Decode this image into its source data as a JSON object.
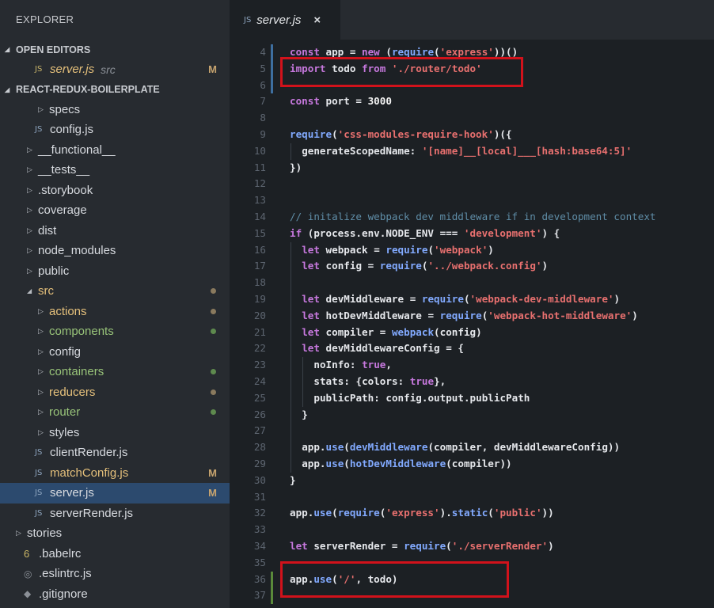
{
  "sidebar": {
    "title": "EXPLORER",
    "open_editors": {
      "header": "OPEN EDITORS",
      "files": [
        {
          "name": "server.js",
          "desc": "src",
          "status": "M"
        }
      ]
    },
    "project": {
      "header": "REACT-REDUX-BOILERPLATE",
      "items": [
        {
          "label": "specs",
          "kind": "folder",
          "depth": 2
        },
        {
          "label": "config.js",
          "kind": "js",
          "depth": 1
        },
        {
          "label": "__functional__",
          "kind": "folder",
          "depth": 1
        },
        {
          "label": "__tests__",
          "kind": "folder",
          "depth": 1
        },
        {
          "label": ".storybook",
          "kind": "folder",
          "depth": 1
        },
        {
          "label": "coverage",
          "kind": "folder",
          "depth": 1
        },
        {
          "label": "dist",
          "kind": "folder",
          "depth": 1
        },
        {
          "label": "node_modules",
          "kind": "folder",
          "depth": 1
        },
        {
          "label": "public",
          "kind": "folder",
          "depth": 1
        },
        {
          "label": "src",
          "kind": "folder-open",
          "depth": 1,
          "color": "#e5c07b",
          "dot": "#8a7a5e"
        },
        {
          "label": "actions",
          "kind": "folder",
          "depth": 2,
          "color": "#e5c07b",
          "dot": "#8a7a5e"
        },
        {
          "label": "components",
          "kind": "folder",
          "depth": 2,
          "color": "#98c379",
          "dot": "#5e8a4e"
        },
        {
          "label": "config",
          "kind": "folder",
          "depth": 2
        },
        {
          "label": "containers",
          "kind": "folder",
          "depth": 2,
          "color": "#98c379",
          "dot": "#5e8a4e"
        },
        {
          "label": "reducers",
          "kind": "folder",
          "depth": 2,
          "color": "#e5c07b",
          "dot": "#8a7a5e"
        },
        {
          "label": "router",
          "kind": "folder",
          "depth": 2,
          "color": "#98c379",
          "dot": "#5e8a4e"
        },
        {
          "label": "styles",
          "kind": "folder",
          "depth": 2
        },
        {
          "label": "clientRender.js",
          "kind": "js",
          "depth": 1
        },
        {
          "label": "matchConfig.js",
          "kind": "js",
          "depth": 1,
          "color": "#e5c07b",
          "status": "M"
        },
        {
          "label": "server.js",
          "kind": "js",
          "depth": 1,
          "status": "M",
          "selected": true
        },
        {
          "label": "serverRender.js",
          "kind": "js",
          "depth": 1
        },
        {
          "label": "stories",
          "kind": "folder",
          "depth": 0
        },
        {
          "label": ".babelrc",
          "kind": "babel",
          "depth": 0
        },
        {
          "label": ".eslintrc.js",
          "kind": "eslint",
          "depth": 0
        },
        {
          "label": ".gitignore",
          "kind": "git",
          "depth": 0
        }
      ]
    }
  },
  "editor": {
    "tab": {
      "label": "server.js",
      "close": "×"
    },
    "lines": [
      {
        "n": "4",
        "indent": 0,
        "mark": "#3e6fa0",
        "tokens": [
          [
            "kw",
            "const "
          ],
          [
            "plain",
            "app "
          ],
          [
            "plain",
            "= "
          ],
          [
            "kw",
            "new "
          ],
          [
            "plain",
            "("
          ],
          [
            "var",
            "require"
          ],
          [
            "plain",
            "("
          ],
          [
            "str",
            "'express'"
          ],
          [
            "plain",
            "))()"
          ]
        ]
      },
      {
        "n": "5",
        "indent": 0,
        "mark": "#3e6fa0",
        "tokens": [
          [
            "kw",
            "import "
          ],
          [
            "plain",
            "todo "
          ],
          [
            "kw",
            "from "
          ],
          [
            "str",
            "'./router/todo'"
          ]
        ]
      },
      {
        "n": "6",
        "indent": 0,
        "mark": "#3e6fa0",
        "tokens": []
      },
      {
        "n": "7",
        "indent": 0,
        "tokens": [
          [
            "kw",
            "const "
          ],
          [
            "plain",
            "port "
          ],
          [
            "plain",
            "= "
          ],
          [
            "num",
            "3000"
          ]
        ]
      },
      {
        "n": "8",
        "indent": 0,
        "tokens": []
      },
      {
        "n": "9",
        "indent": 0,
        "tokens": [
          [
            "var",
            "require"
          ],
          [
            "plain",
            "("
          ],
          [
            "str",
            "'css-modules-require-hook'"
          ],
          [
            "plain",
            ")({"
          ]
        ]
      },
      {
        "n": "10",
        "indent": 1,
        "tokens": [
          [
            "prop",
            "generateScopedName"
          ],
          [
            "plain",
            ": "
          ],
          [
            "str",
            "'[name]__[local]___[hash:base64:5]'"
          ]
        ]
      },
      {
        "n": "11",
        "indent": 0,
        "tokens": [
          [
            "plain",
            "})"
          ]
        ]
      },
      {
        "n": "12",
        "indent": 0,
        "tokens": []
      },
      {
        "n": "13",
        "indent": 0,
        "tokens": []
      },
      {
        "n": "14",
        "indent": 0,
        "tokens": [
          [
            "cmt",
            "// initalize webpack dev middleware if in development context"
          ]
        ]
      },
      {
        "n": "15",
        "indent": 0,
        "tokens": [
          [
            "kw",
            "if "
          ],
          [
            "plain",
            "(process.env.NODE_ENV "
          ],
          [
            "plain",
            "=== "
          ],
          [
            "str",
            "'development'"
          ],
          [
            "plain",
            ") {"
          ]
        ]
      },
      {
        "n": "16",
        "indent": 1,
        "tokens": [
          [
            "kw",
            "let "
          ],
          [
            "plain",
            "webpack "
          ],
          [
            "plain",
            "= "
          ],
          [
            "var",
            "require"
          ],
          [
            "plain",
            "("
          ],
          [
            "str",
            "'webpack'"
          ],
          [
            "plain",
            ")"
          ]
        ]
      },
      {
        "n": "17",
        "indent": 1,
        "tokens": [
          [
            "kw",
            "let "
          ],
          [
            "plain",
            "config "
          ],
          [
            "plain",
            "= "
          ],
          [
            "var",
            "require"
          ],
          [
            "plain",
            "("
          ],
          [
            "str",
            "'../webpack.config'"
          ],
          [
            "plain",
            ")"
          ]
        ]
      },
      {
        "n": "18",
        "indent": 1,
        "tokens": []
      },
      {
        "n": "19",
        "indent": 1,
        "tokens": [
          [
            "kw",
            "let "
          ],
          [
            "plain",
            "devMiddleware "
          ],
          [
            "plain",
            "= "
          ],
          [
            "var",
            "require"
          ],
          [
            "plain",
            "("
          ],
          [
            "str",
            "'webpack-dev-middleware'"
          ],
          [
            "plain",
            ")"
          ]
        ]
      },
      {
        "n": "20",
        "indent": 1,
        "tokens": [
          [
            "kw",
            "let "
          ],
          [
            "plain",
            "hotDevMiddleware "
          ],
          [
            "plain",
            "= "
          ],
          [
            "var",
            "require"
          ],
          [
            "plain",
            "("
          ],
          [
            "str",
            "'webpack-hot-middleware'"
          ],
          [
            "plain",
            ")"
          ]
        ]
      },
      {
        "n": "21",
        "indent": 1,
        "tokens": [
          [
            "kw",
            "let "
          ],
          [
            "plain",
            "compiler "
          ],
          [
            "plain",
            "= "
          ],
          [
            "var",
            "webpack"
          ],
          [
            "plain",
            "(config)"
          ]
        ]
      },
      {
        "n": "22",
        "indent": 1,
        "tokens": [
          [
            "kw",
            "let "
          ],
          [
            "plain",
            "devMiddlewareConfig "
          ],
          [
            "plain",
            "= {"
          ]
        ]
      },
      {
        "n": "23",
        "indent": 2,
        "tokens": [
          [
            "prop",
            "noInfo"
          ],
          [
            "plain",
            ": "
          ],
          [
            "kw",
            "true"
          ],
          [
            "plain",
            ","
          ]
        ]
      },
      {
        "n": "24",
        "indent": 2,
        "tokens": [
          [
            "prop",
            "stats"
          ],
          [
            "plain",
            ": {"
          ],
          [
            "prop",
            "colors"
          ],
          [
            "plain",
            ": "
          ],
          [
            "kw",
            "true"
          ],
          [
            "plain",
            "},"
          ]
        ]
      },
      {
        "n": "25",
        "indent": 2,
        "tokens": [
          [
            "prop",
            "publicPath"
          ],
          [
            "plain",
            ": config.output.publicPath"
          ]
        ]
      },
      {
        "n": "26",
        "indent": 1,
        "tokens": [
          [
            "plain",
            "}"
          ]
        ]
      },
      {
        "n": "27",
        "indent": 1,
        "tokens": []
      },
      {
        "n": "28",
        "indent": 1,
        "tokens": [
          [
            "plain",
            "app."
          ],
          [
            "var",
            "use"
          ],
          [
            "plain",
            "("
          ],
          [
            "var",
            "devMiddleware"
          ],
          [
            "plain",
            "(compiler, devMiddlewareConfig))"
          ]
        ]
      },
      {
        "n": "29",
        "indent": 1,
        "tokens": [
          [
            "plain",
            "app."
          ],
          [
            "var",
            "use"
          ],
          [
            "plain",
            "("
          ],
          [
            "var",
            "hotDevMiddleware"
          ],
          [
            "plain",
            "(compiler))"
          ]
        ]
      },
      {
        "n": "30",
        "indent": 0,
        "tokens": [
          [
            "plain",
            "}"
          ]
        ]
      },
      {
        "n": "31",
        "indent": 0,
        "tokens": []
      },
      {
        "n": "32",
        "indent": 0,
        "tokens": [
          [
            "plain",
            "app."
          ],
          [
            "var",
            "use"
          ],
          [
            "plain",
            "("
          ],
          [
            "var",
            "require"
          ],
          [
            "plain",
            "("
          ],
          [
            "str",
            "'express'"
          ],
          [
            "plain",
            ")."
          ],
          [
            "var",
            "static"
          ],
          [
            "plain",
            "("
          ],
          [
            "str",
            "'public'"
          ],
          [
            "plain",
            "))"
          ]
        ]
      },
      {
        "n": "33",
        "indent": 0,
        "tokens": []
      },
      {
        "n": "34",
        "indent": 0,
        "tokens": [
          [
            "kw",
            "let "
          ],
          [
            "plain",
            "serverRender "
          ],
          [
            "plain",
            "= "
          ],
          [
            "var",
            "require"
          ],
          [
            "plain",
            "("
          ],
          [
            "str",
            "'./serverRender'"
          ],
          [
            "plain",
            ")"
          ]
        ]
      },
      {
        "n": "35",
        "indent": 0,
        "tokens": []
      },
      {
        "n": "36",
        "indent": 0,
        "mark": "#5a8a3a",
        "tokens": [
          [
            "plain",
            "app."
          ],
          [
            "var",
            "use"
          ],
          [
            "plain",
            "("
          ],
          [
            "str",
            "'/'"
          ],
          [
            "plain",
            ", todo)"
          ]
        ]
      },
      {
        "n": "37",
        "indent": 0,
        "mark": "#5a8a3a",
        "tokens": []
      }
    ],
    "highlight_color": "#d1121b"
  }
}
